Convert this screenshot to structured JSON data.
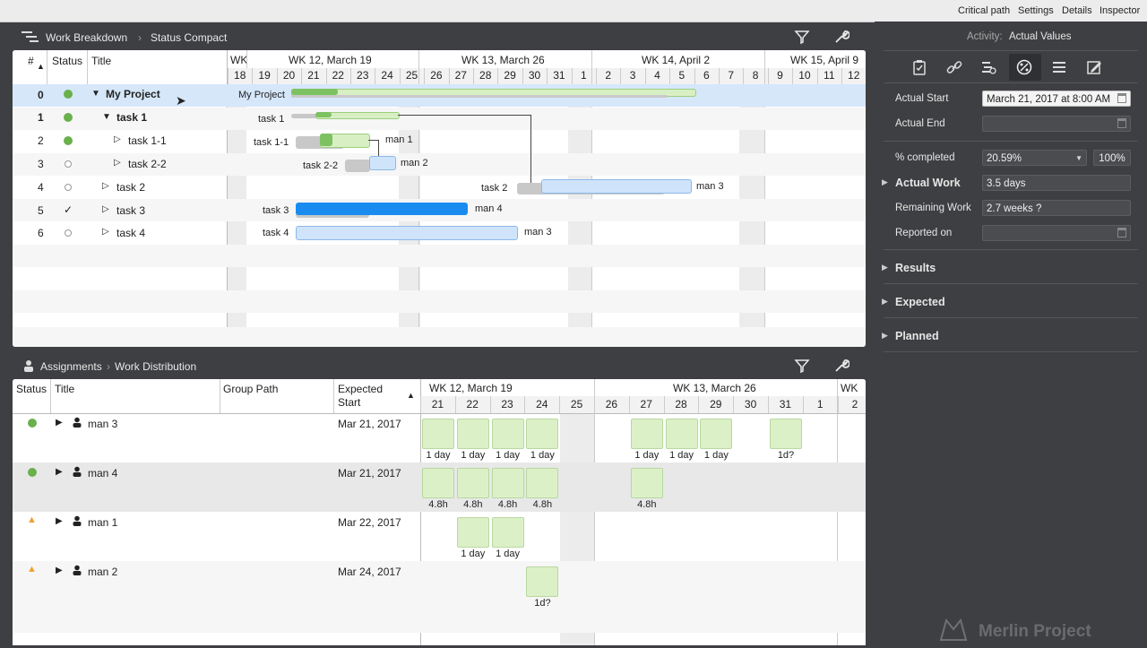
{
  "topbar": {
    "items": [
      "Critical path",
      "Settings",
      "Details",
      "Inspector"
    ]
  },
  "top_panel": {
    "breadcrumb": [
      "Work Breakdown",
      "Status Compact"
    ],
    "columns": {
      "num": "#",
      "status": "Status",
      "title": "Title"
    },
    "weeks": [
      "WK",
      "WK 12, March 19",
      "WK 13, March 26",
      "WK 14, April 2",
      "WK 15, April 9"
    ],
    "days": [
      "18",
      "19",
      "20",
      "21",
      "22",
      "23",
      "24",
      "25",
      "26",
      "27",
      "28",
      "29",
      "30",
      "31",
      "1",
      "2",
      "3",
      "4",
      "5",
      "6",
      "7",
      "8",
      "9",
      "10",
      "11",
      "12"
    ],
    "rows": [
      {
        "num": "0",
        "status": "green",
        "title": "My Project",
        "bar_label": "My Project",
        "resource": ""
      },
      {
        "num": "1",
        "status": "green",
        "title": "task 1",
        "bar_label": "task 1",
        "resource": ""
      },
      {
        "num": "2",
        "status": "green",
        "title": "task 1-1",
        "bar_label": "task 1-1",
        "resource": "man 1"
      },
      {
        "num": "3",
        "status": "empty",
        "title": "task 2-2",
        "bar_label": "task 2-2",
        "resource": "man 2"
      },
      {
        "num": "4",
        "status": "empty",
        "title": "task 2",
        "bar_label": "task 2",
        "resource": "man 3"
      },
      {
        "num": "5",
        "status": "check",
        "title": "task 3",
        "bar_label": "task 3",
        "resource": "man 4"
      },
      {
        "num": "6",
        "status": "empty",
        "title": "task 4",
        "bar_label": "task 4",
        "resource": "man 3"
      }
    ]
  },
  "bottom_panel": {
    "breadcrumb": [
      "Assignments",
      "Work Distribution"
    ],
    "columns": {
      "status": "Status",
      "title": "Title",
      "group_path": "Group Path",
      "expected_start": "Expected Start"
    },
    "weeks": [
      "WK 12, March 19",
      "WK 13, March 26",
      "WK"
    ],
    "days": [
      "21",
      "22",
      "23",
      "24",
      "25",
      "26",
      "27",
      "28",
      "29",
      "30",
      "31",
      "1",
      "2"
    ],
    "rows": [
      {
        "status": "green",
        "title": "man 3",
        "expected_start": "Mar 21, 2017",
        "cells": [
          {
            "day": "21",
            "label": "1 day"
          },
          {
            "day": "22",
            "label": "1 day"
          },
          {
            "day": "23",
            "label": "1 day"
          },
          {
            "day": "24",
            "label": "1 day"
          },
          {
            "day": "27",
            "label": "1 day"
          },
          {
            "day": "28",
            "label": "1 day"
          },
          {
            "day": "29",
            "label": "1 day"
          },
          {
            "day": "31",
            "label": "1d?"
          }
        ]
      },
      {
        "status": "green",
        "title": "man 4",
        "expected_start": "Mar 21, 2017",
        "cells": [
          {
            "day": "21",
            "label": "4.8h"
          },
          {
            "day": "22",
            "label": "4.8h"
          },
          {
            "day": "23",
            "label": "4.8h"
          },
          {
            "day": "24",
            "label": "4.8h"
          },
          {
            "day": "27",
            "label": "4.8h"
          }
        ]
      },
      {
        "status": "warning",
        "title": "man 1",
        "expected_start": "Mar 22, 2017",
        "cells": [
          {
            "day": "22",
            "label": "1 day"
          },
          {
            "day": "23",
            "label": "1 day"
          }
        ]
      },
      {
        "status": "warning",
        "title": "man 2",
        "expected_start": "Mar 24, 2017",
        "cells": [
          {
            "day": "24",
            "label": "1d?"
          }
        ]
      }
    ]
  },
  "inspector": {
    "header_prefix": "Activity:",
    "header_title": "Actual Values",
    "tab_icons": [
      "clipboard-check-icon",
      "link-icon",
      "resource-icon",
      "percent-icon",
      "list-icon",
      "edit-icon"
    ],
    "actual_start_label": "Actual Start",
    "actual_start_value": "March 21, 2017 at 8:00 AM",
    "actual_end_label": "Actual End",
    "actual_end_value": "",
    "percent_label": "% completed",
    "percent_value": "20.59%",
    "percent_button": "100%",
    "actual_work_label": "Actual Work",
    "actual_work_value": "3.5 days",
    "remaining_work_label": "Remaining Work",
    "remaining_work_value": "2.7 weeks ?",
    "reported_on_label": "Reported on",
    "reported_on_value": "",
    "sections": [
      "Results",
      "Expected",
      "Planned"
    ]
  },
  "branding": {
    "watermark": "Merlin Project"
  },
  "colors": {
    "accent_blue": "#1a8cf0",
    "light_blue": "#cfe4fb",
    "green": "#6ab04c",
    "warning": "#f0a030",
    "bar_green_light": "#d8efc4",
    "bar_green": "#7dc160"
  }
}
